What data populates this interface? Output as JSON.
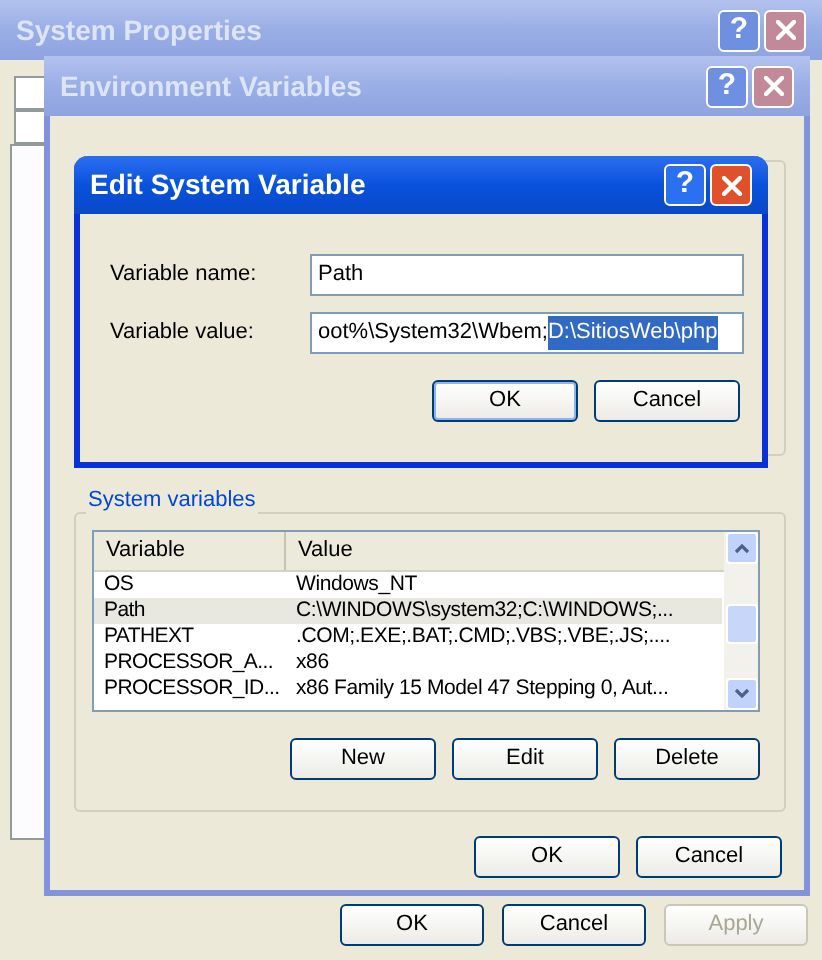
{
  "system_properties": {
    "title": "System Properties",
    "help_button": "?",
    "active": false,
    "buttons": [
      {
        "label": "OK",
        "disabled": false
      },
      {
        "label": "Cancel",
        "disabled": false
      },
      {
        "label": "Apply",
        "disabled": true
      }
    ]
  },
  "environment_variables": {
    "title": "Environment Variables",
    "help_button": "?",
    "active": false,
    "system_variables": {
      "label": "System variables",
      "columns": [
        "Variable",
        "Value"
      ],
      "rows": [
        {
          "variable": "OS",
          "value": "Windows_NT",
          "selected": false
        },
        {
          "variable": "Path",
          "value": "C:\\WINDOWS\\system32;C:\\WINDOWS;...",
          "selected": true
        },
        {
          "variable": "PATHEXT",
          "value": ".COM;.EXE;.BAT;.CMD;.VBS;.VBE;.JS;....",
          "selected": false
        },
        {
          "variable": "PROCESSOR_A...",
          "value": "x86",
          "selected": false
        },
        {
          "variable": "PROCESSOR_ID...",
          "value": "x86 Family 15 Model 47 Stepping 0, Aut...",
          "selected": false
        }
      ],
      "buttons": [
        "New",
        "Edit",
        "Delete"
      ]
    },
    "buttons": [
      "OK",
      "Cancel"
    ]
  },
  "edit_system_variable": {
    "title": "Edit System Variable",
    "help_button": "?",
    "active": true,
    "fields": [
      {
        "label": "Variable name:",
        "parts": [
          {
            "text": "Path",
            "selected": false
          }
        ]
      },
      {
        "label": "Variable value:",
        "parts": [
          {
            "text": "oot%\\System32\\Wbem;",
            "selected": false
          },
          {
            "text": "D:\\SitiosWeb\\php",
            "selected": true
          }
        ]
      }
    ],
    "buttons": [
      {
        "label": "OK",
        "default": true
      },
      {
        "label": "Cancel",
        "default": false
      }
    ]
  }
}
